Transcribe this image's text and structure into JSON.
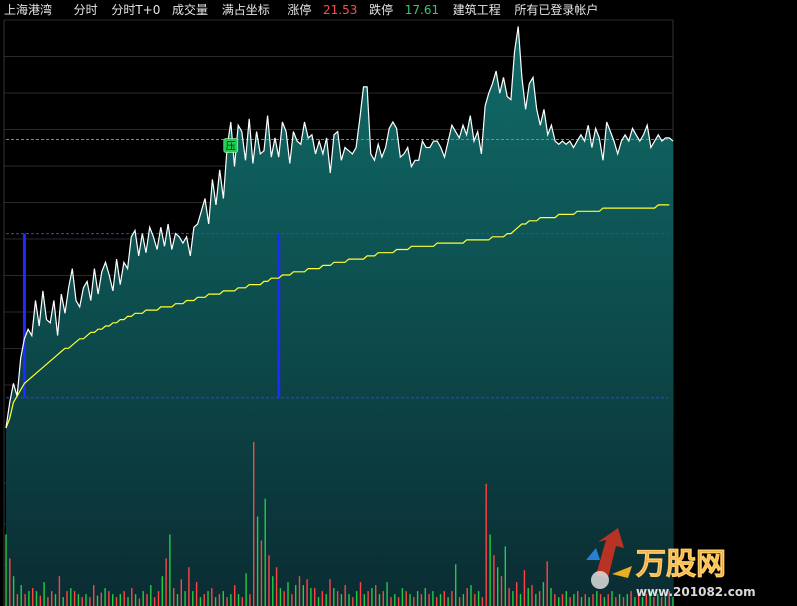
{
  "header": {
    "stock_name": "上海港湾",
    "mode_intraday": "分时",
    "mode_t0": "分时T+0",
    "volume_label": "成交量",
    "full_axis": "满占坐标",
    "limit_up_label": "涨停",
    "limit_up_value": "21.53",
    "limit_down_label": "跌停",
    "limit_down_value": "17.61",
    "sector": "建筑工程",
    "logged_in": "所有已登录帐户"
  },
  "badge": {
    "text": "压"
  },
  "watermark": {
    "brand": "万股网",
    "url": "www.201082.com"
  },
  "colors": {
    "price_line": "#ffffff",
    "avg_line": "#ffff33",
    "fill_top": "#0f6a66",
    "fill_bottom": "#0a2a30",
    "up": "#ff4444",
    "down": "#22cc44",
    "resistance": "#22cc22",
    "support": "#1e3cff",
    "marker": "#1e2bff"
  },
  "chart_data": {
    "type": "line",
    "ylim": [
      0,
      100
    ],
    "resistance_level": 90.5,
    "upper_level": 61.0,
    "lower_level": 9.5,
    "markers": [
      {
        "x": 5,
        "y_from": 9.5,
        "y_to": 61.0
      },
      {
        "x": 74,
        "y_from": 9.5,
        "y_to": 61.0
      }
    ],
    "series": [
      {
        "values": [
          0,
          8,
          14,
          10,
          22,
          28,
          31,
          29,
          40,
          32,
          43,
          34,
          33,
          40,
          29,
          42,
          36,
          44,
          50,
          40,
          38,
          44,
          46,
          40,
          50,
          42,
          49,
          52,
          48,
          43,
          53,
          45,
          52,
          50,
          60,
          62,
          54,
          61,
          55,
          63,
          60,
          56,
          63,
          57,
          64,
          56,
          61,
          60,
          58,
          60,
          54,
          63,
          64,
          68,
          72,
          64,
          78,
          70,
          81,
          72,
          88,
          96,
          82,
          95,
          93,
          84,
          97,
          83,
          93,
          86,
          87,
          98,
          85,
          91,
          85,
          96,
          93,
          83,
          93,
          90,
          89,
          96,
          91,
          92,
          86,
          90,
          86,
          91,
          80,
          92,
          93,
          84,
          88,
          87,
          86,
          88,
          97,
          107,
          107,
          86,
          84,
          89,
          85,
          88,
          94,
          96,
          94,
          85,
          86,
          88,
          82,
          84,
          84,
          90,
          88,
          88,
          90,
          90,
          88,
          85,
          90,
          95,
          93,
          91,
          95,
          92,
          98,
          90,
          93,
          86,
          101,
          105,
          108,
          112,
          105,
          110,
          104,
          103,
          118,
          126,
          110,
          100,
          108,
          110,
          100,
          95,
          100,
          92,
          95,
          90,
          89,
          90,
          89,
          90,
          88,
          90,
          92,
          90,
          95,
          88,
          94,
          91,
          84,
          96,
          93,
          90,
          86,
          90,
          92,
          90,
          94,
          92,
          90,
          92,
          95,
          88,
          90,
          92,
          90,
          91,
          91,
          90
        ],
        "role": "price"
      },
      {
        "values": [
          0,
          3,
          8,
          10,
          12,
          14,
          15,
          16,
          17,
          18,
          19,
          20,
          21,
          22,
          23,
          24,
          25,
          25,
          26,
          27,
          28,
          28,
          29,
          30,
          30,
          31,
          31,
          32,
          32,
          33,
          33,
          34,
          34,
          35,
          35,
          36,
          36,
          36,
          37,
          37,
          37,
          37,
          38,
          38,
          38,
          38,
          39,
          39,
          39,
          40,
          40,
          40,
          41,
          41,
          41,
          42,
          42,
          42,
          42,
          43,
          43,
          43,
          43,
          44,
          44,
          44,
          45,
          45,
          45,
          45,
          46,
          46,
          47,
          47,
          47,
          48,
          48,
          48,
          49,
          49,
          49,
          49,
          50,
          50,
          50,
          50,
          51,
          51,
          51,
          52,
          52,
          52,
          52,
          53,
          53,
          53,
          53,
          53,
          54,
          54,
          54,
          55,
          55,
          55,
          55,
          55,
          56,
          56,
          56,
          56,
          57,
          57,
          57,
          57,
          57,
          57,
          57,
          58,
          58,
          58,
          58,
          58,
          58,
          58,
          58,
          59,
          59,
          59,
          59,
          59,
          59,
          59,
          60,
          60,
          60,
          60,
          61,
          61,
          62,
          63,
          64,
          64,
          65,
          65,
          65,
          66,
          66,
          66,
          66,
          66,
          67,
          67,
          67,
          67,
          67,
          68,
          68,
          68,
          68,
          68,
          68,
          68,
          69,
          69,
          69,
          69,
          69,
          69,
          69,
          69,
          69,
          69,
          69,
          69,
          69,
          69,
          69,
          70,
          70,
          70,
          70
        ],
        "role": "average"
      }
    ],
    "volume": {
      "values": [
        48,
        32,
        20,
        8,
        14,
        8,
        10,
        12,
        10,
        7,
        16,
        6,
        10,
        8,
        20,
        6,
        10,
        12,
        10,
        8,
        6,
        8,
        6,
        14,
        7,
        9,
        12,
        10,
        8,
        6,
        8,
        10,
        6,
        12,
        8,
        5,
        10,
        8,
        14,
        6,
        10,
        20,
        32,
        48,
        12,
        8,
        18,
        10,
        26,
        10,
        16,
        6,
        8,
        10,
        12,
        6,
        8,
        10,
        6,
        8,
        14,
        8,
        6,
        22,
        8,
        110,
        60,
        44,
        72,
        34,
        20,
        26,
        12,
        10,
        16,
        8,
        14,
        20,
        14,
        18,
        12,
        12,
        6,
        10,
        8,
        18,
        12,
        10,
        8,
        14,
        8,
        6,
        10,
        16,
        8,
        10,
        12,
        14,
        8,
        10,
        16,
        6,
        8,
        6,
        12,
        10,
        8,
        6,
        10,
        8,
        12,
        8,
        10,
        6,
        8,
        10,
        6,
        10,
        28,
        6,
        8,
        12,
        14,
        8,
        10,
        6,
        82,
        48,
        34,
        26,
        20,
        40,
        12,
        10,
        16,
        8,
        24,
        12,
        14,
        8,
        10,
        16,
        30,
        12,
        8,
        6,
        8,
        10,
        6,
        8,
        10,
        6,
        8,
        6,
        8,
        10,
        8,
        6,
        8,
        10,
        6,
        8,
        6,
        8,
        10,
        6,
        8,
        6,
        8,
        10,
        6,
        8,
        6,
        8,
        10,
        6
      ],
      "colors": [
        "d",
        "u",
        "d",
        "u",
        "d",
        "u",
        "d",
        "u",
        "d",
        "u",
        "d",
        "u",
        "u",
        "d",
        "u",
        "d",
        "u",
        "d",
        "u",
        "d",
        "u",
        "d",
        "u",
        "u",
        "d",
        "u",
        "d",
        "u",
        "d",
        "u",
        "d",
        "u",
        "d",
        "u",
        "d",
        "u",
        "d",
        "u",
        "d",
        "u",
        "u",
        "d",
        "u",
        "d",
        "u",
        "d",
        "u",
        "d",
        "u",
        "d",
        "u",
        "d",
        "u",
        "d",
        "u",
        "d",
        "u",
        "d",
        "u",
        "d",
        "u",
        "d",
        "u",
        "d",
        "u",
        "u",
        "d",
        "u",
        "d",
        "u",
        "d",
        "u",
        "d",
        "u",
        "d",
        "u",
        "d",
        "u",
        "d",
        "u",
        "d",
        "u",
        "d",
        "u",
        "d",
        "u",
        "d",
        "u",
        "d",
        "u",
        "d",
        "u",
        "d",
        "u",
        "d",
        "u",
        "d",
        "u",
        "d",
        "u",
        "d",
        "u",
        "d",
        "u",
        "d",
        "u",
        "d",
        "u",
        "d",
        "u",
        "d",
        "u",
        "d",
        "u",
        "d",
        "u",
        "d",
        "u",
        "d",
        "u",
        "d",
        "u",
        "d",
        "u",
        "d",
        "u",
        "u",
        "d",
        "u",
        "d",
        "u",
        "d",
        "u",
        "d",
        "u",
        "d",
        "u",
        "d",
        "u",
        "d",
        "u",
        "d",
        "u",
        "d",
        "u",
        "d",
        "u",
        "d",
        "u",
        "d",
        "u",
        "d",
        "u",
        "d",
        "u",
        "d",
        "u",
        "d",
        "u",
        "d",
        "u",
        "d",
        "u",
        "d",
        "u",
        "d",
        "u",
        "d",
        "u",
        "d",
        "u",
        "d",
        "u",
        "d",
        "u",
        "d",
        "u",
        "d",
        "u",
        "d"
      ]
    }
  }
}
